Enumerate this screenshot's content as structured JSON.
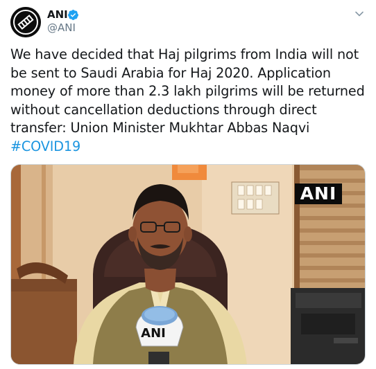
{
  "tweet": {
    "author": {
      "name": "ANI",
      "handle": "@ANI",
      "verified": true,
      "avatar_icon": "ani-logo-icon"
    },
    "menu_icon": "chevron-down-icon",
    "text": "We have decided that Haj pilgrims from India will not be sent to Saudi Arabia for Haj 2020. Application money of more than 2.3 lakh pilgrims will be returned without cancellation deductions through direct transfer: Union Minister Mukhtar Abbas Naqvi",
    "hashtag": "#COVID19",
    "media": {
      "watermark": "ANI",
      "mic_label": "ANI"
    }
  },
  "colors": {
    "hashtag": "#1b95e0",
    "verified": "#1da1f2",
    "secondary_text": "#657786",
    "primary_text": "#14171a"
  }
}
